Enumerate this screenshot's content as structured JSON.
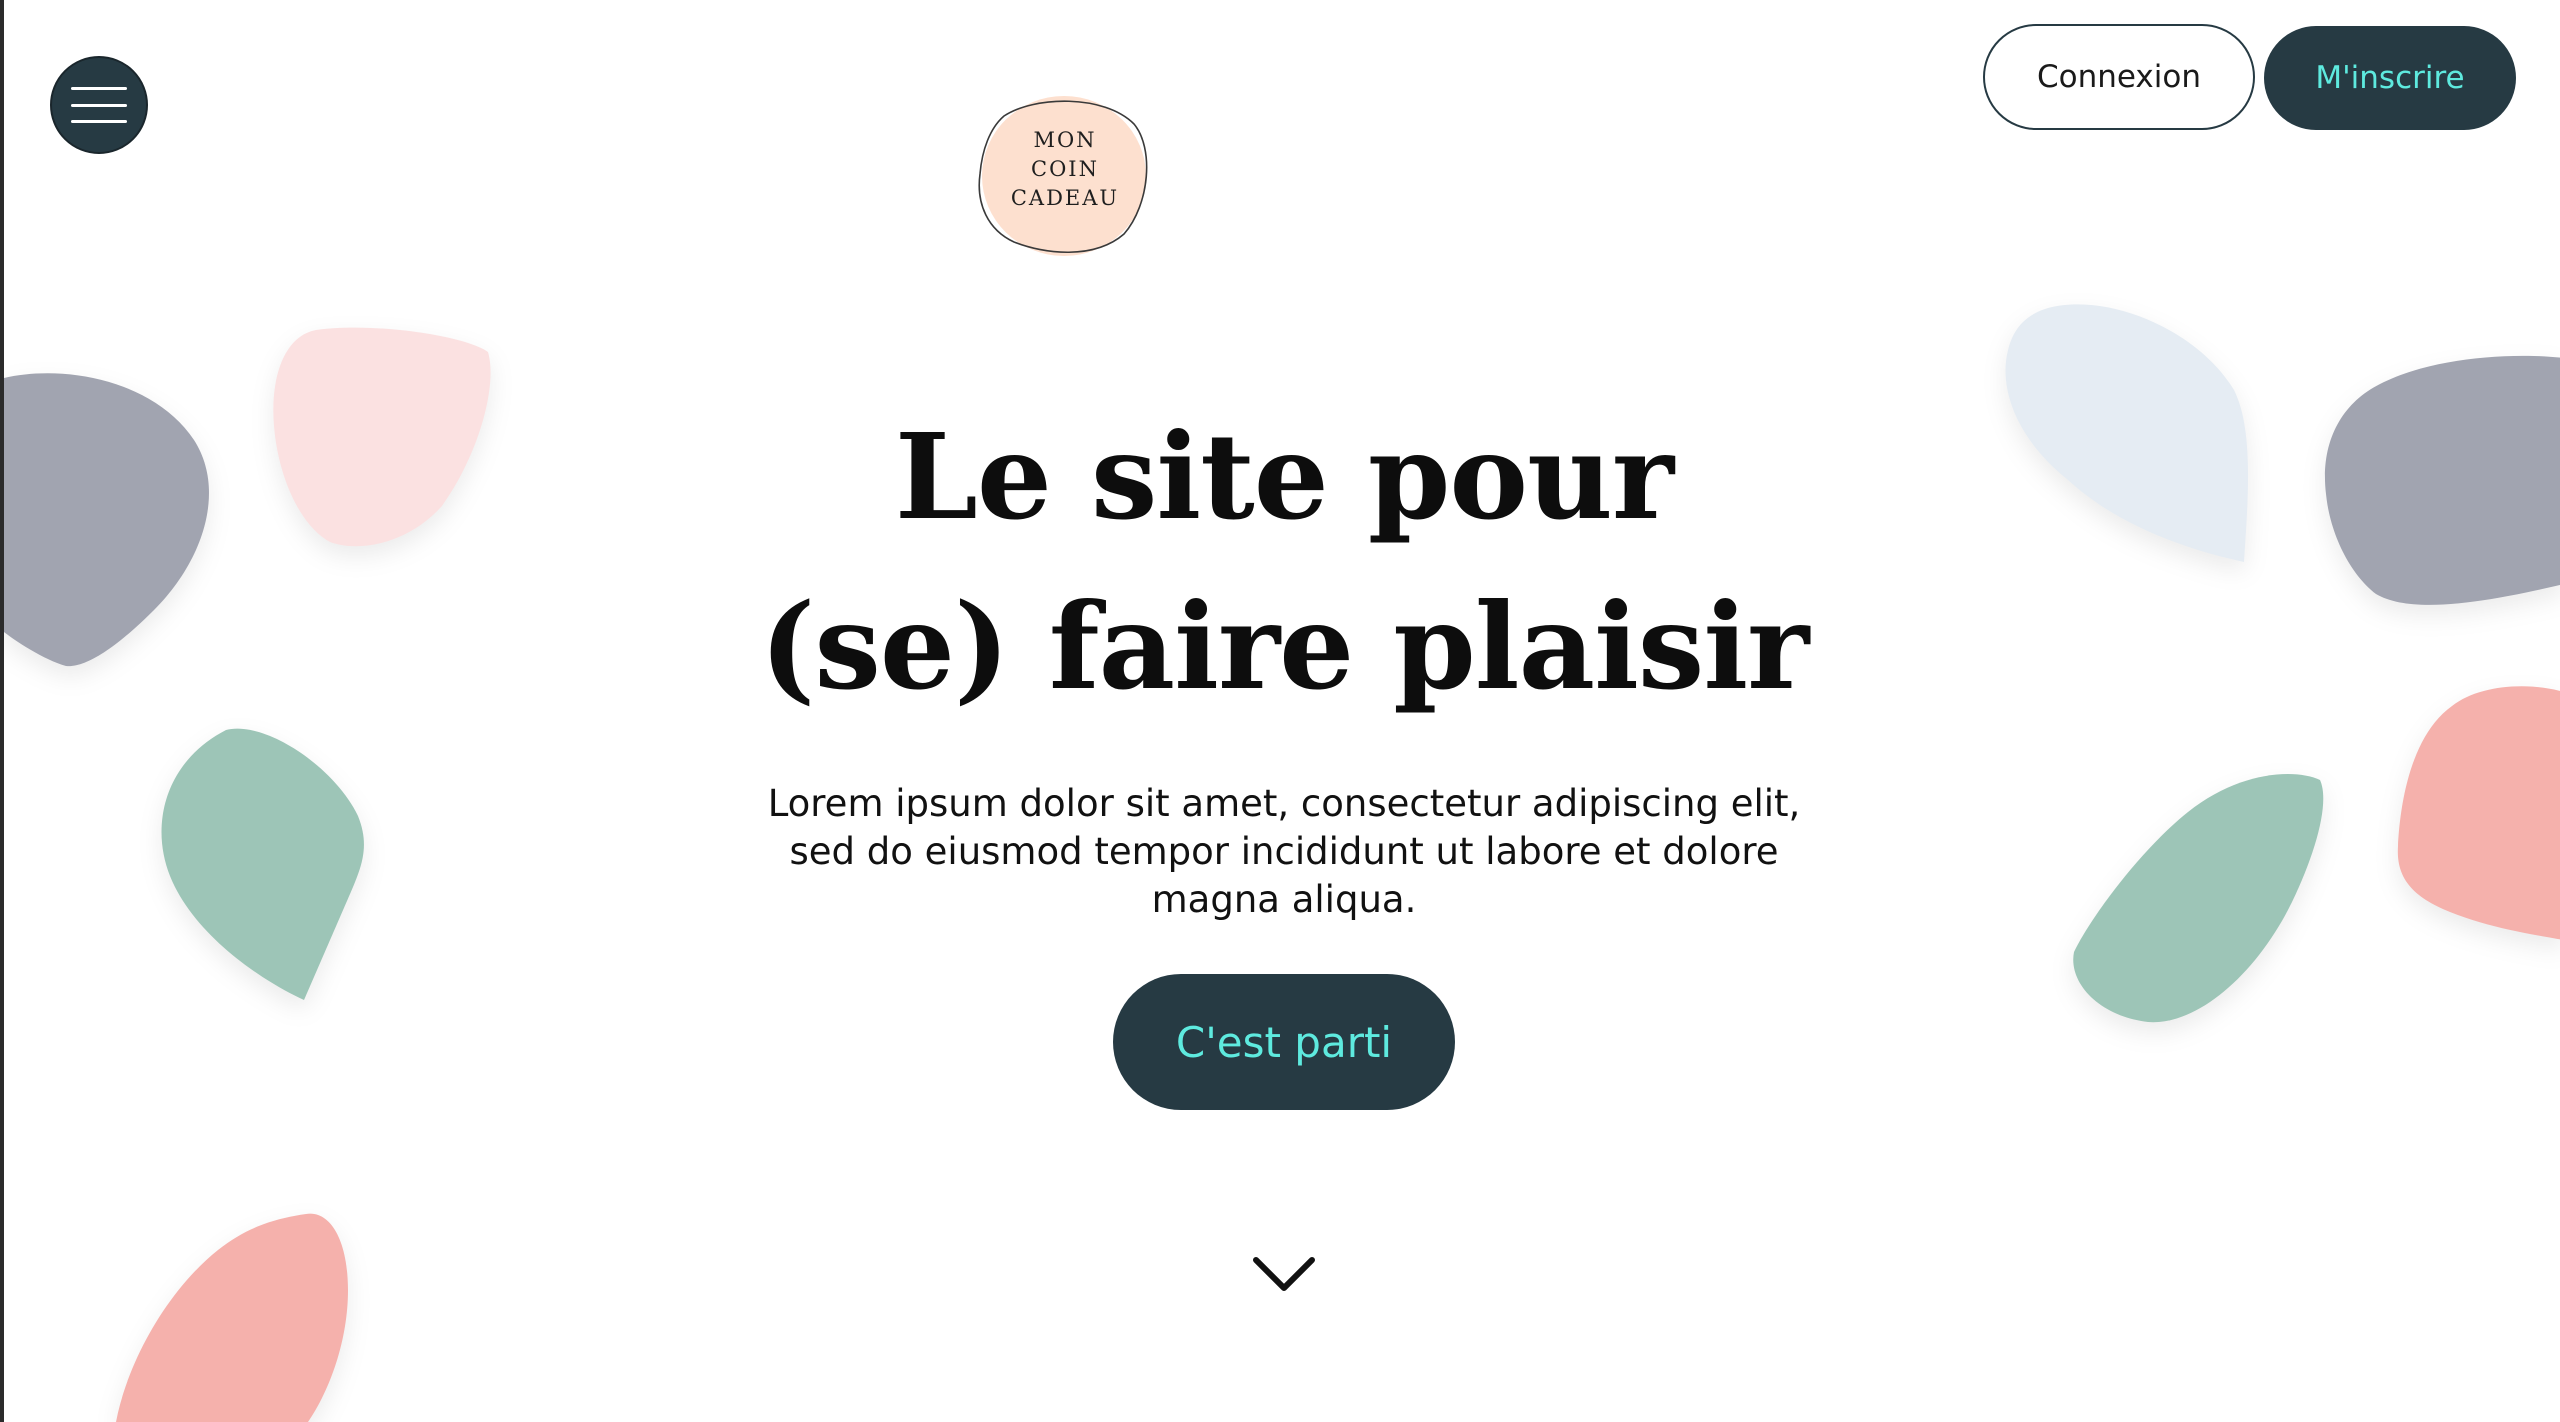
{
  "header": {
    "menu_icon": "hamburger-menu-icon",
    "logo_lines": [
      "MON",
      "COIN",
      "CADEAU"
    ],
    "login_label": "Connexion",
    "signup_label": "M'inscrire"
  },
  "hero": {
    "title_line1": "Le site pour",
    "title_line2": "(se) faire plaisir",
    "subtitle": "Lorem ipsum dolor sit amet, consectetur adipiscing elit, sed do eiusmod tempor incididunt ut labore et dolore magna aliqua.",
    "cta_label": "C'est parti",
    "scroll_icon": "chevron-down-icon"
  },
  "colors": {
    "primary_dark": "#263a43",
    "accent_teal": "#5eeadf",
    "logo_peach": "#fde0cf",
    "blob_gray": "#a1a4b0",
    "blob_pink_light": "#fbe1e1",
    "blob_green": "#9dc5b7",
    "blob_coral": "#f5b1ac",
    "blob_blue_light": "#e5ecf3"
  }
}
